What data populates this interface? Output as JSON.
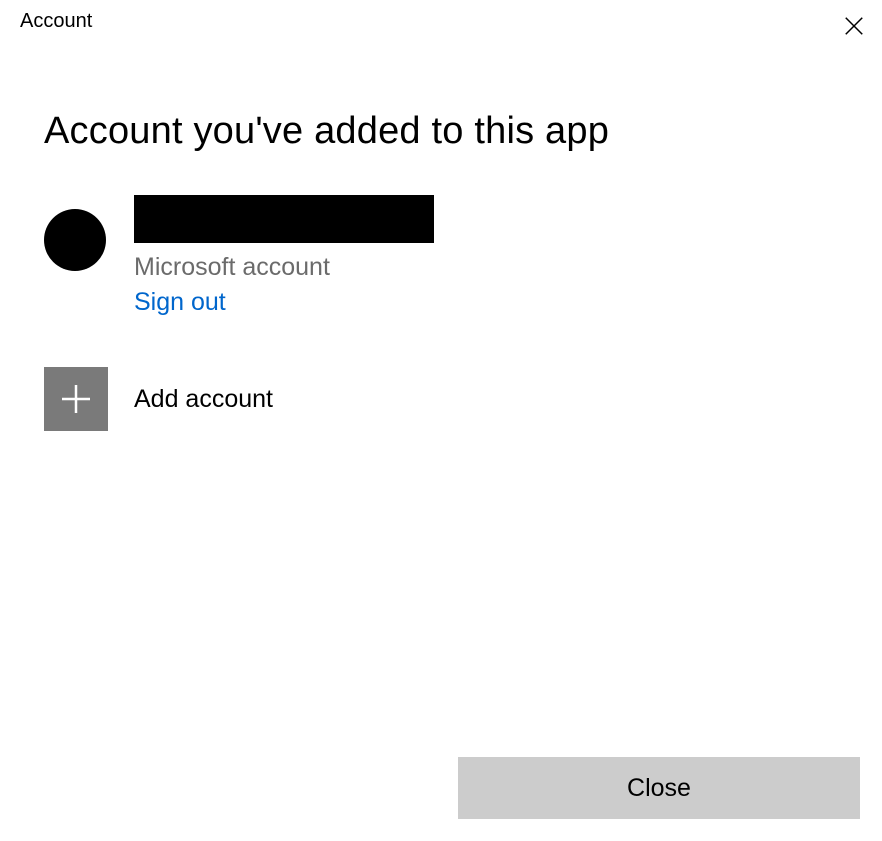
{
  "header": {
    "title": "Account"
  },
  "main": {
    "heading": "Account you've added to this app",
    "account": {
      "name": "",
      "type": "Microsoft account",
      "sign_out_label": "Sign out"
    },
    "add_account_label": "Add account"
  },
  "footer": {
    "close_label": "Close"
  }
}
